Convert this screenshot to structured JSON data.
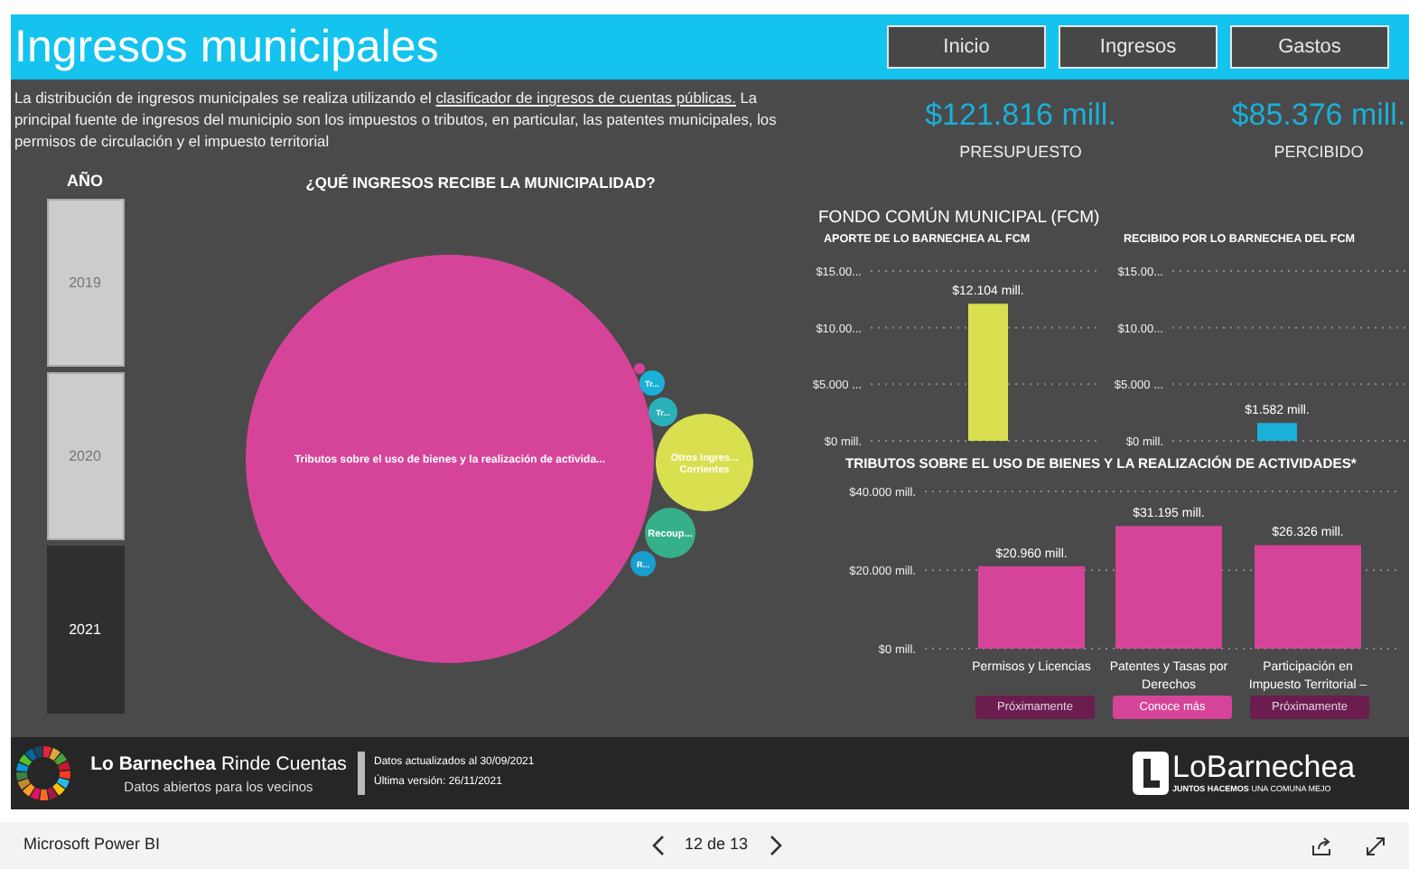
{
  "header": {
    "title": "Ingresos municipales",
    "nav": [
      {
        "label": "Inicio"
      },
      {
        "label": "Ingresos"
      },
      {
        "label": "Gastos"
      }
    ]
  },
  "intro": {
    "before": "La distribución de ingresos municipales se realiza utilizando el ",
    "link": "clasificador de ingresos de cuentas públicas.",
    "after": " La principal fuente de ingresos del municipio son los impuestos o tributos, en particular, las patentes municipales, los permisos de circulación y el impuesto territorial"
  },
  "year_slicer": {
    "title": "AÑO",
    "items": [
      {
        "label": "2019",
        "selected": false
      },
      {
        "label": "2020",
        "selected": false
      },
      {
        "label": "2021",
        "selected": true
      }
    ]
  },
  "bubble_chart": {
    "title": "¿QUÉ INGRESOS RECIBE LA MUNICIPALIDAD?",
    "bubbles": [
      {
        "label": "Tributos sobre el uso de bienes y la realización de activida...",
        "color": "#d6449a"
      },
      {
        "color": "#d6449a"
      },
      {
        "label": "Tr...",
        "color": "#1ab0d8"
      },
      {
        "label": "Tr...",
        "color": "#2ab0b8"
      },
      {
        "label": "Otros Ingres... Corrientes",
        "color": "#d9e04f"
      },
      {
        "label": "Recoup...",
        "color": "#36b08a"
      },
      {
        "label": "R...",
        "color": "#1a9ed0"
      }
    ]
  },
  "kpis": [
    {
      "value": "$121.816 mill.",
      "label": "PRESUPUESTO"
    },
    {
      "value": "$85.376 mill.",
      "label": "PERCIBIDO"
    }
  ],
  "fcm": {
    "title": "FONDO COMÚN MUNICIPAL (FCM)",
    "charts": [
      {
        "title": "APORTE DE LO BARNECHEA AL FCM",
        "axis_labels": [
          "$15.00...",
          "$10.00...",
          "$5.000 ...",
          "$0 mill."
        ],
        "bar": {
          "value_label": "$12.104 mill.",
          "color": "#d9e04f",
          "level": 0.807
        }
      },
      {
        "title": "RECIBIDO POR LO BARNECHEA DEL FCM",
        "axis_labels": [
          "$15.00...",
          "$10.00...",
          "$5.000 ...",
          "$0 mill."
        ],
        "bar": {
          "value_label": "$1.582 mill.",
          "color": "#1ab0d8",
          "level": 0.105
        }
      }
    ]
  },
  "tributos": {
    "title": "TRIBUTOS SOBRE EL USO DE BIENES Y LA REALIZACIÓN DE ACTIVIDADES*",
    "chart_data": {
      "type": "bar",
      "categories": [
        "Permisos y Licencias",
        "Patentes y Tasas por Derechos",
        "Participación en Impuesto Territorial –"
      ],
      "series": [
        {
          "color": "#d6449a",
          "values": [
            20960,
            31195,
            26326
          ]
        }
      ],
      "ylim": [
        0,
        40000
      ],
      "yticks": [
        {
          "value": 0,
          "label": "$0 mill."
        },
        {
          "value": 20000,
          "label": "$20.000 mill."
        },
        {
          "value": 40000,
          "label": "$40.000 mill."
        }
      ],
      "value_labels": [
        "$20.960 mill.",
        "$31.195 mill.",
        "$26.326 mill."
      ]
    },
    "buttons": [
      {
        "label": "Próximamente",
        "disabled": true
      },
      {
        "label": "Conoce más",
        "disabled": false
      },
      {
        "label": "Próximamente",
        "disabled": true
      }
    ]
  },
  "footer": {
    "brand": "**Lo Barnechea** Rinde Cuentas",
    "subtitle": "Datos abiertos para los vecinos",
    "updated": "Datos actualizados al 30/09/2021",
    "version": "Última versión: 26/11/2021",
    "logo_text": "LoBarnechea",
    "logo_tagline": "**JUNTOS HACEMOS** UNA COMUNA MEJO"
  },
  "viewer": {
    "app": "Microsoft Power BI",
    "page": "12 de 13"
  }
}
